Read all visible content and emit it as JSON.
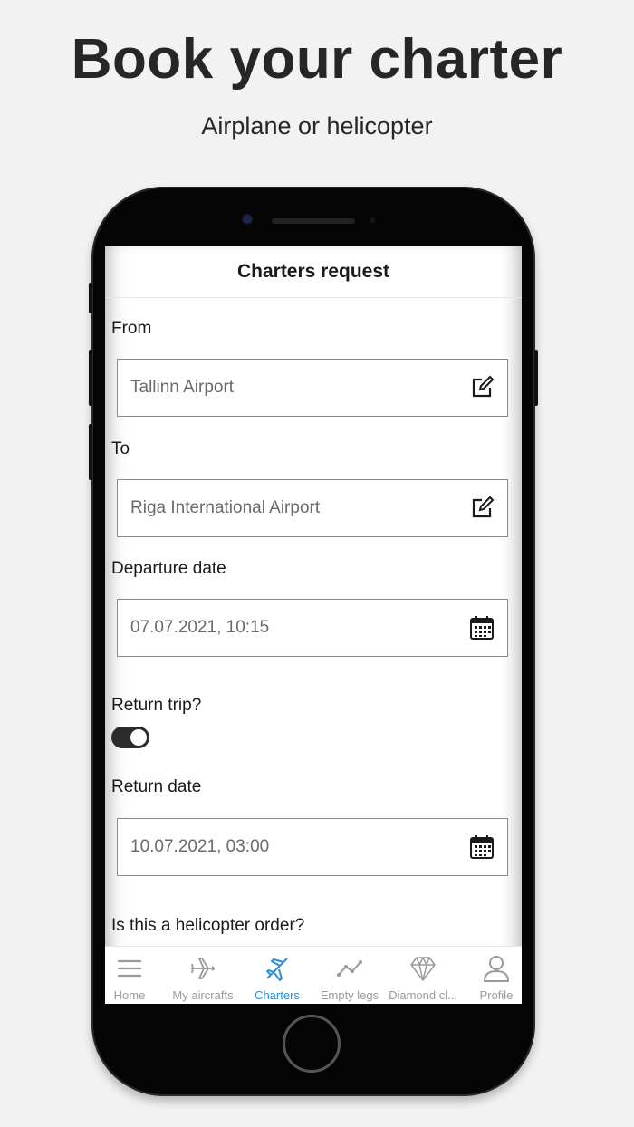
{
  "hero": {
    "title": "Book your charter",
    "subtitle": "Airplane or helicopter"
  },
  "screen": {
    "title": "Charters request",
    "form": {
      "from_label": "From",
      "from_value": "Tallinn Airport",
      "to_label": "To",
      "to_value": "Riga International Airport",
      "departure_label": "Departure date",
      "departure_value": "07.07.2021, 10:15",
      "return_trip_label": "Return trip?",
      "return_trip_on": true,
      "return_date_label": "Return date",
      "return_date_value": "10.07.2021, 03:00",
      "helicopter_label": "Is this a helicopter order?"
    },
    "tabs": [
      {
        "label": "Home",
        "icon": "menu-icon",
        "active": false
      },
      {
        "label": "My aircrafts",
        "icon": "airplane-icon",
        "active": false
      },
      {
        "label": "Charters",
        "icon": "plane-takeoff-icon",
        "active": true
      },
      {
        "label": "Empty legs",
        "icon": "route-icon",
        "active": false
      },
      {
        "label": "Diamond cl...",
        "icon": "diamond-icon",
        "active": false
      },
      {
        "label": "Profile",
        "icon": "user-icon",
        "active": false
      }
    ]
  },
  "colors": {
    "accent": "#2a8fd6",
    "inactive": "#9a9a9a",
    "background": "#f2f2f2"
  }
}
